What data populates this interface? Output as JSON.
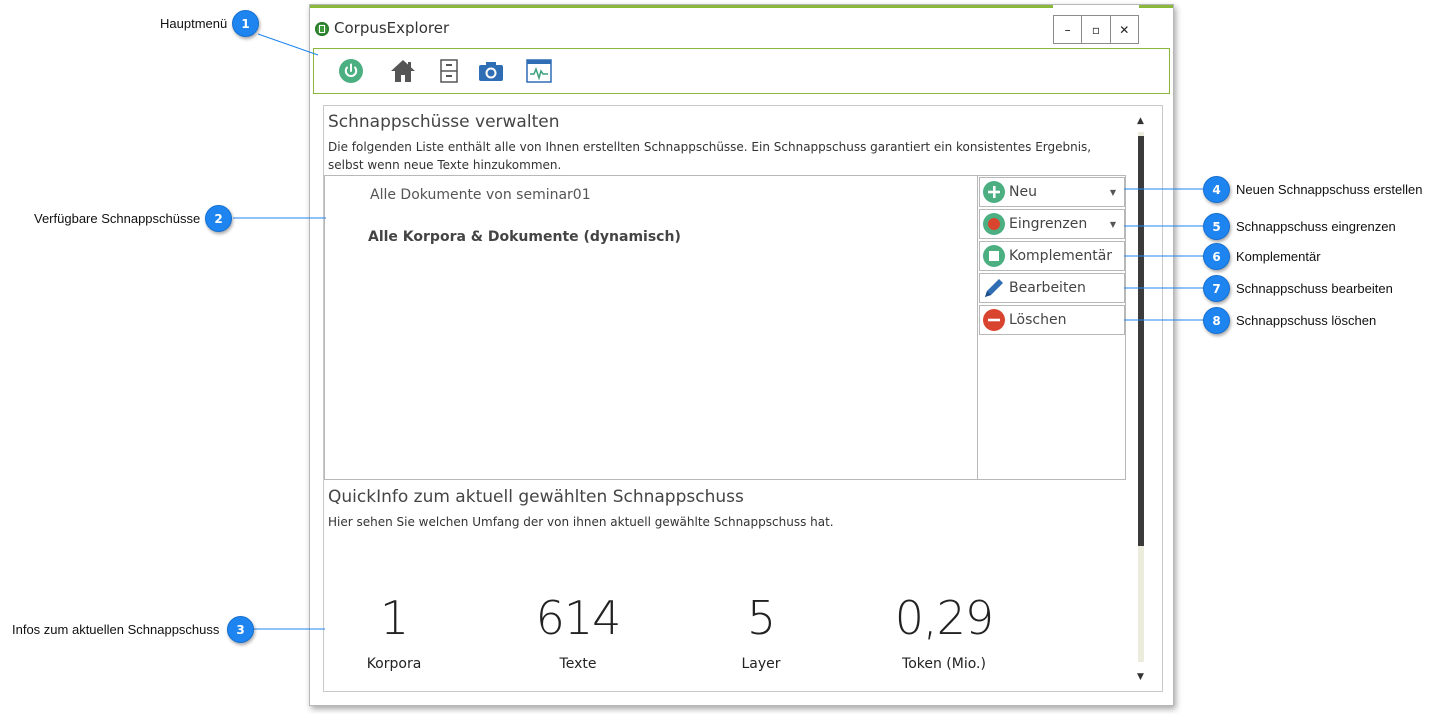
{
  "window": {
    "title": "CorpusExplorer",
    "minimize_label": "–",
    "maximize_label": "▫",
    "close_label": "✕"
  },
  "toolbar": {
    "icons": [
      "power-icon",
      "home-icon",
      "cabinet-icon",
      "camera-icon",
      "monitor-icon"
    ]
  },
  "snapshots": {
    "title": "Schnappschüsse verwalten",
    "description_line1": "Die folgenden Liste enthält alle von Ihnen erstellten Schnappschüsse. Ein Schnappschuss garantiert ein konsistentes Ergebnis,",
    "description_line2": "selbst wenn neue Texte hinzukommen.",
    "items": [
      {
        "label": "Alle Dokumente von seminar01",
        "bold": false
      },
      {
        "label": "Alle Korpora & Dokumente  (dynamisch)",
        "bold": true
      }
    ],
    "actions": [
      {
        "label": "Neu",
        "icon": "plus-icon",
        "color": "#4caf82",
        "has_dropdown": true
      },
      {
        "label": "Eingrenzen",
        "icon": "record-icon",
        "color": "#d9442e",
        "has_dropdown": true
      },
      {
        "label": "Komplementär",
        "icon": "square-icon",
        "color": "#4caf82",
        "has_dropdown": false
      },
      {
        "label": "Bearbeiten",
        "icon": "pencil-icon",
        "color": "#2f6db5",
        "has_dropdown": false
      },
      {
        "label": "Löschen",
        "icon": "minus-icon",
        "color": "#d9442e",
        "has_dropdown": false
      }
    ]
  },
  "quickinfo": {
    "title": "QuickInfo zum aktuell gewählten Schnappschuss",
    "description": "Hier sehen Sie welchen Umfang der von ihnen aktuell gewählte Schnappschuss hat.",
    "stats": [
      {
        "value": "1",
        "label": "Korpora"
      },
      {
        "value": "614",
        "label": "Texte"
      },
      {
        "value": "5",
        "label": "Layer"
      },
      {
        "value": "0,29",
        "label": "Token (Mio.)"
      }
    ]
  },
  "annotations": [
    {
      "number": "1",
      "text": "Hauptmenü"
    },
    {
      "number": "2",
      "text": "Verfügbare Schnappschüsse"
    },
    {
      "number": "3",
      "text": "Infos zum aktuellen Schnappschuss"
    },
    {
      "number": "4",
      "text": "Neuen Schnappschuss erstellen"
    },
    {
      "number": "5",
      "text": "Schnappschuss eingrenzen"
    },
    {
      "number": "6",
      "text": "Komplementär"
    },
    {
      "number": "7",
      "text": "Schnappschuss bearbeiten"
    },
    {
      "number": "8",
      "text": "Schnappschuss löschen"
    }
  ],
  "colors": {
    "accent_green": "#8ab83b",
    "callout_blue": "#1e84f0"
  }
}
